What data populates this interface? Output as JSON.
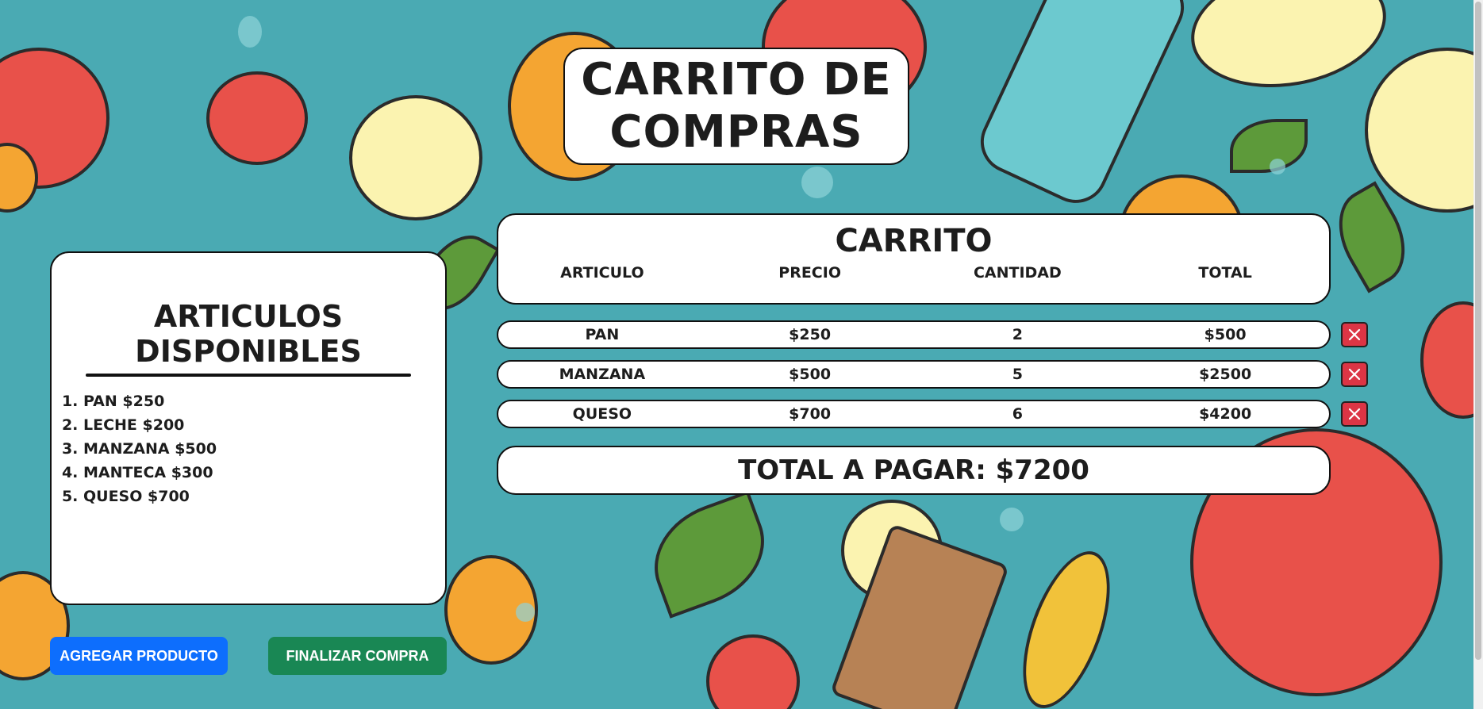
{
  "page": {
    "title": "CARRITO DE COMPRAS"
  },
  "available": {
    "heading": "ARTICULOS DISPONIBLES",
    "items": [
      "PAN $250",
      "LECHE $200",
      "MANZANA $500",
      "MANTECA $300",
      "QUESO $700"
    ]
  },
  "cart": {
    "heading": "CARRITO",
    "columns": [
      "ARTICULO",
      "PRECIO",
      "CANTIDAD",
      "TOTAL"
    ],
    "rows": [
      {
        "item": "PAN",
        "price": "$250",
        "qty": "2",
        "total": "$500"
      },
      {
        "item": "MANZANA",
        "price": "$500",
        "qty": "5",
        "total": "$2500"
      },
      {
        "item": "QUESO",
        "price": "$700",
        "qty": "6",
        "total": "$4200"
      }
    ],
    "grand_total": "TOTAL A PAGAR: $7200",
    "delete_icon": "close-icon"
  },
  "buttons": {
    "add": "AGREGAR PRODUCTO",
    "finish": "FINALIZAR COMPRA"
  },
  "colors": {
    "add": "#0d6efd",
    "finish": "#198754",
    "delete": "#dc3545"
  }
}
